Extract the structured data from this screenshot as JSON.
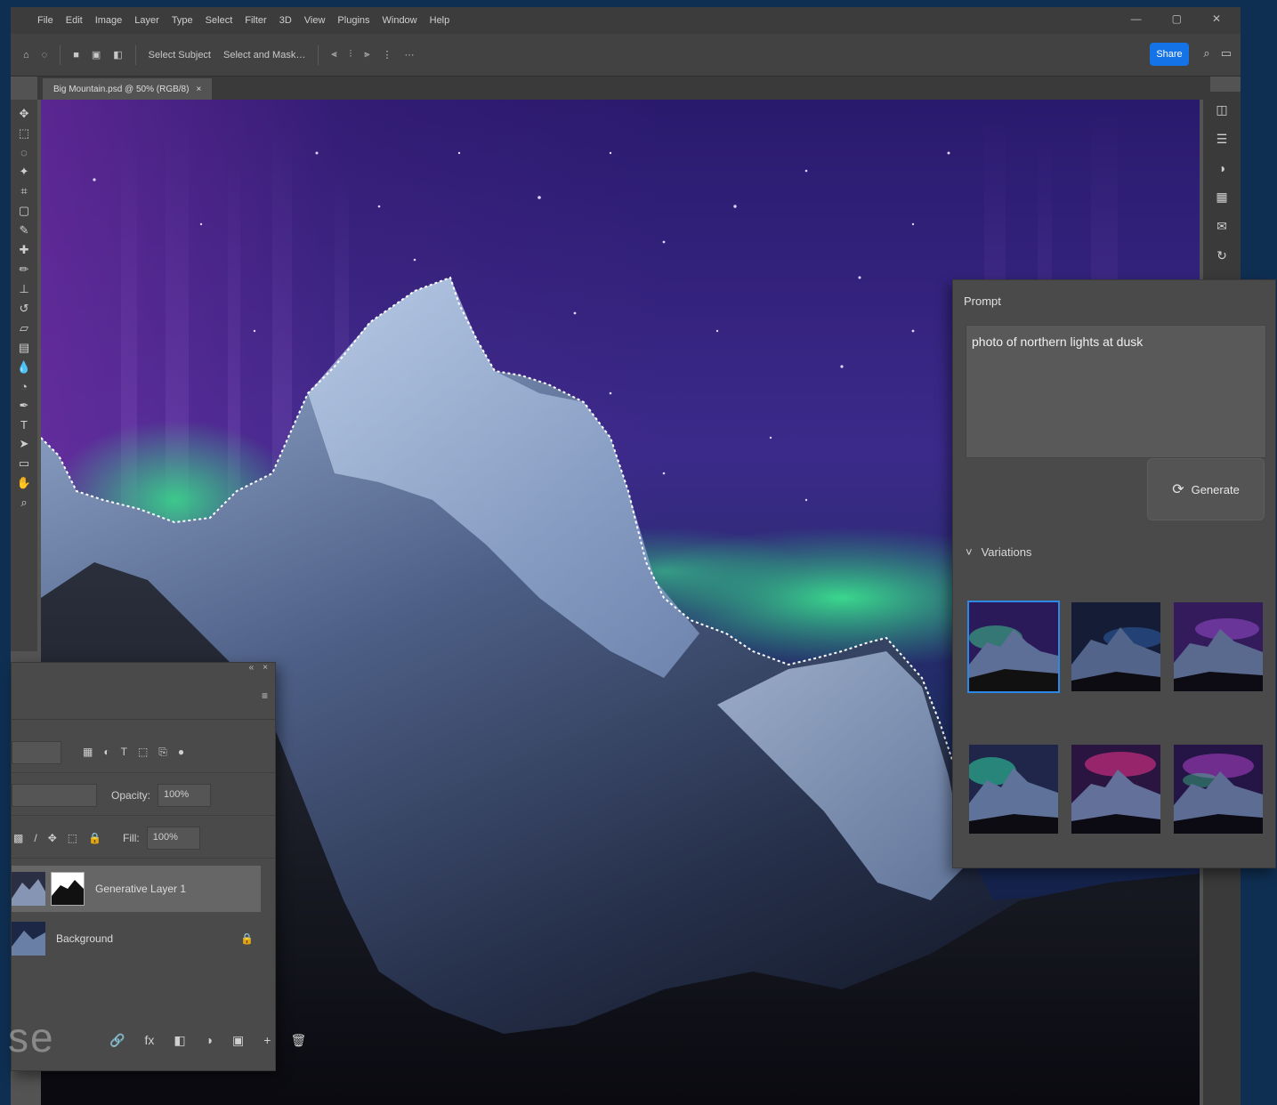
{
  "menu": [
    "File",
    "Edit",
    "Image",
    "Layer",
    "Type",
    "Select",
    "Filter",
    "3D",
    "View",
    "Plugins",
    "Window",
    "Help"
  ],
  "window_controls": [
    "—",
    "▢",
    "✕"
  ],
  "options_bar": {
    "home_icon": "home-icon",
    "tool_icon": "lasso-icon",
    "items": [
      "Select Subject",
      "Select and Mask…"
    ],
    "share_label": "Share",
    "icons": [
      "search-icon",
      "layout-icon"
    ]
  },
  "document_tab": {
    "title": "Big Mountain.psd @ 50% (RGB/8)",
    "close": "×"
  },
  "prompt_panel": {
    "title": "Prompt",
    "text": "photo of northern lights at dusk",
    "generate_label": "Generate",
    "variations_label": "Variations",
    "variations_arrow": "˅"
  },
  "layers_panel": {
    "opacity_label": "Opacity:",
    "opacity_value": "100%",
    "fill_label": "Fill:",
    "fill_value": "100%",
    "layers": [
      {
        "name": "Generative Layer 1",
        "active": true
      },
      {
        "name": "Background",
        "locked": true
      }
    ],
    "watermark": "se",
    "lock_icon": "🔒",
    "bottom_icons": [
      "🔗",
      "fx",
      "◧",
      "◑",
      "▣",
      "+",
      "🗑"
    ],
    "filter_icons": [
      "▦",
      "◐",
      "T",
      "⬚",
      "⎘",
      "●"
    ],
    "lock_icons": [
      "▩",
      "/",
      "✥",
      "⬚",
      "🔒"
    ],
    "top_icons": [
      "«",
      "×"
    ],
    "menu_icon": "≡"
  },
  "toolbar_icons": [
    "move-icon",
    "marquee-icon",
    "lasso-icon",
    "magic-wand-icon",
    "crop-icon",
    "frame-icon",
    "eyedropper-icon",
    "healing-icon",
    "brush-icon",
    "stamp-icon",
    "history-brush-icon",
    "eraser-icon",
    "gradient-icon",
    "blur-icon",
    "dodge-icon",
    "pen-icon",
    "type-icon",
    "path-select-icon",
    "shape-icon",
    "hand-icon",
    "zoom-icon"
  ],
  "right_strip_icons": [
    "layers-icon",
    "properties-icon",
    "adjustments-icon",
    "libraries-icon",
    "comments-icon",
    "history-icon"
  ],
  "colors": {
    "accent": "#2d88e8",
    "share": "#1473e6",
    "panel": "#4a4a4a",
    "app_bg": "#535353",
    "desktop": "#0f2f52",
    "aurora_green": "#39d98a",
    "aurora_purple": "#5b2a8a"
  }
}
